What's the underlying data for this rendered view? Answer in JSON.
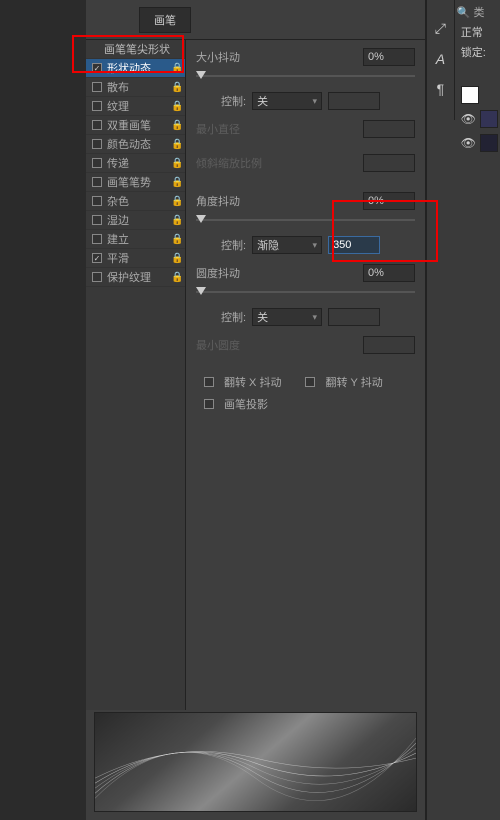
{
  "header": {
    "brush_tab": "画笔"
  },
  "options": [
    {
      "label": "画笔笔尖形状",
      "checked": false,
      "header": true,
      "locked": false
    },
    {
      "label": "形状动态",
      "checked": true,
      "locked": true,
      "selected": true
    },
    {
      "label": "散布",
      "checked": false,
      "locked": true
    },
    {
      "label": "纹理",
      "checked": false,
      "locked": true
    },
    {
      "label": "双重画笔",
      "checked": false,
      "locked": true
    },
    {
      "label": "颜色动态",
      "checked": false,
      "locked": true
    },
    {
      "label": "传递",
      "checked": false,
      "locked": true
    },
    {
      "label": "画笔笔势",
      "checked": false,
      "locked": true
    },
    {
      "label": "杂色",
      "checked": false,
      "locked": true
    },
    {
      "label": "湿边",
      "checked": false,
      "locked": true
    },
    {
      "label": "建立",
      "checked": false,
      "locked": true
    },
    {
      "label": "平滑",
      "checked": true,
      "locked": true
    },
    {
      "label": "保护纹理",
      "checked": false,
      "locked": true
    }
  ],
  "settings": {
    "size_jitter": {
      "label": "大小抖动",
      "value": "0%"
    },
    "control1": {
      "label": "控制:",
      "value": "关",
      "field": ""
    },
    "min_diameter": {
      "label": "最小直径"
    },
    "tilt_scale": {
      "label": "倾斜缩放比例"
    },
    "angle_jitter": {
      "label": "角度抖动",
      "value": "0%"
    },
    "control2": {
      "label": "控制:",
      "value": "渐隐",
      "field": "350"
    },
    "round_jitter": {
      "label": "圆度抖动",
      "value": "0%"
    },
    "control3": {
      "label": "控制:",
      "value": "关",
      "field": ""
    },
    "min_roundness": {
      "label": "最小圆度"
    },
    "flip_x": "翻转 X 抖动",
    "flip_y": "翻转 Y 抖动",
    "brush_proj": "画笔投影"
  },
  "layers": {
    "search_label": "类",
    "mode": "正常",
    "lock_label": "锁定:"
  },
  "icons": {
    "dropper": "⤢",
    "text": "A",
    "paragraph": "¶",
    "search": "🔍",
    "eye": "👁"
  }
}
